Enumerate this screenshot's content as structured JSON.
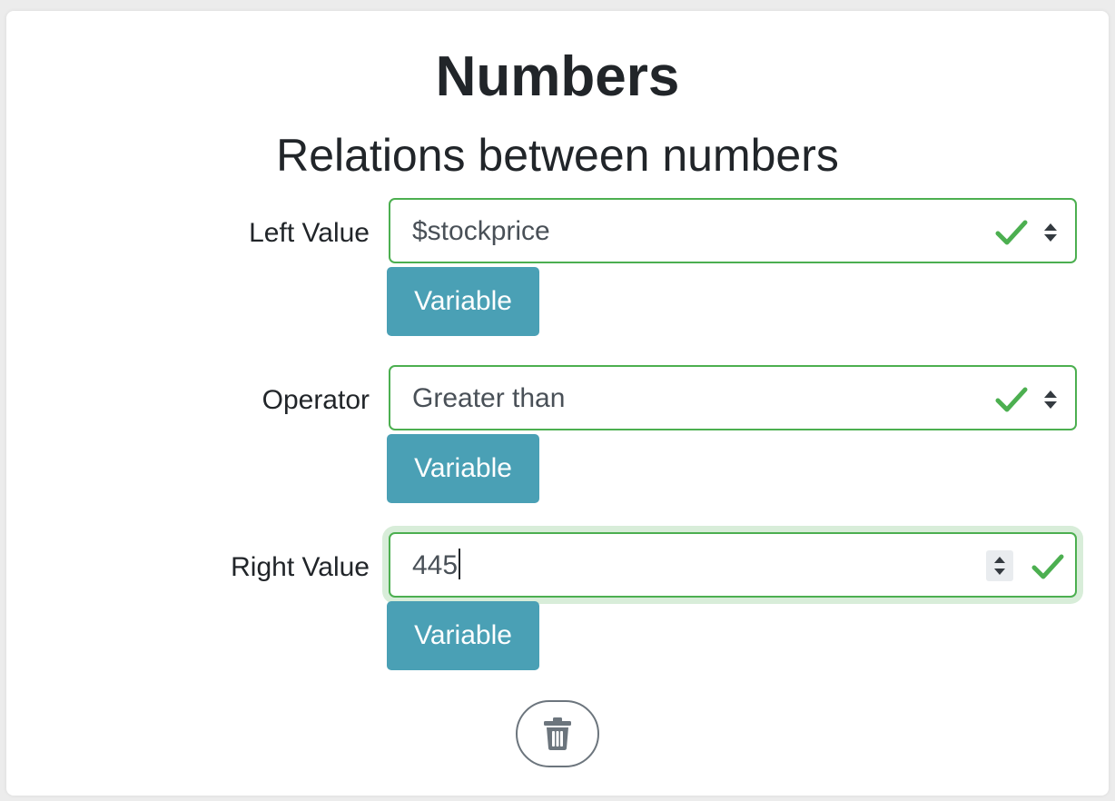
{
  "header": {
    "title": "Numbers",
    "subtitle": "Relations between numbers"
  },
  "rows": [
    {
      "label": "Left Value",
      "value": "$stockprice",
      "kind": "select",
      "valid": true,
      "variable_label": "Variable"
    },
    {
      "label": "Operator",
      "value": "Greater than",
      "kind": "select",
      "valid": true,
      "variable_label": "Variable"
    },
    {
      "label": "Right Value",
      "value": "445",
      "kind": "number",
      "valid": true,
      "focused": true,
      "variable_label": "Variable"
    }
  ],
  "delete_icon": "trash-icon",
  "colors": {
    "valid": "#4caf50",
    "variable_button": "#4aa0b5",
    "text": "#212529",
    "input_text": "#495057"
  }
}
